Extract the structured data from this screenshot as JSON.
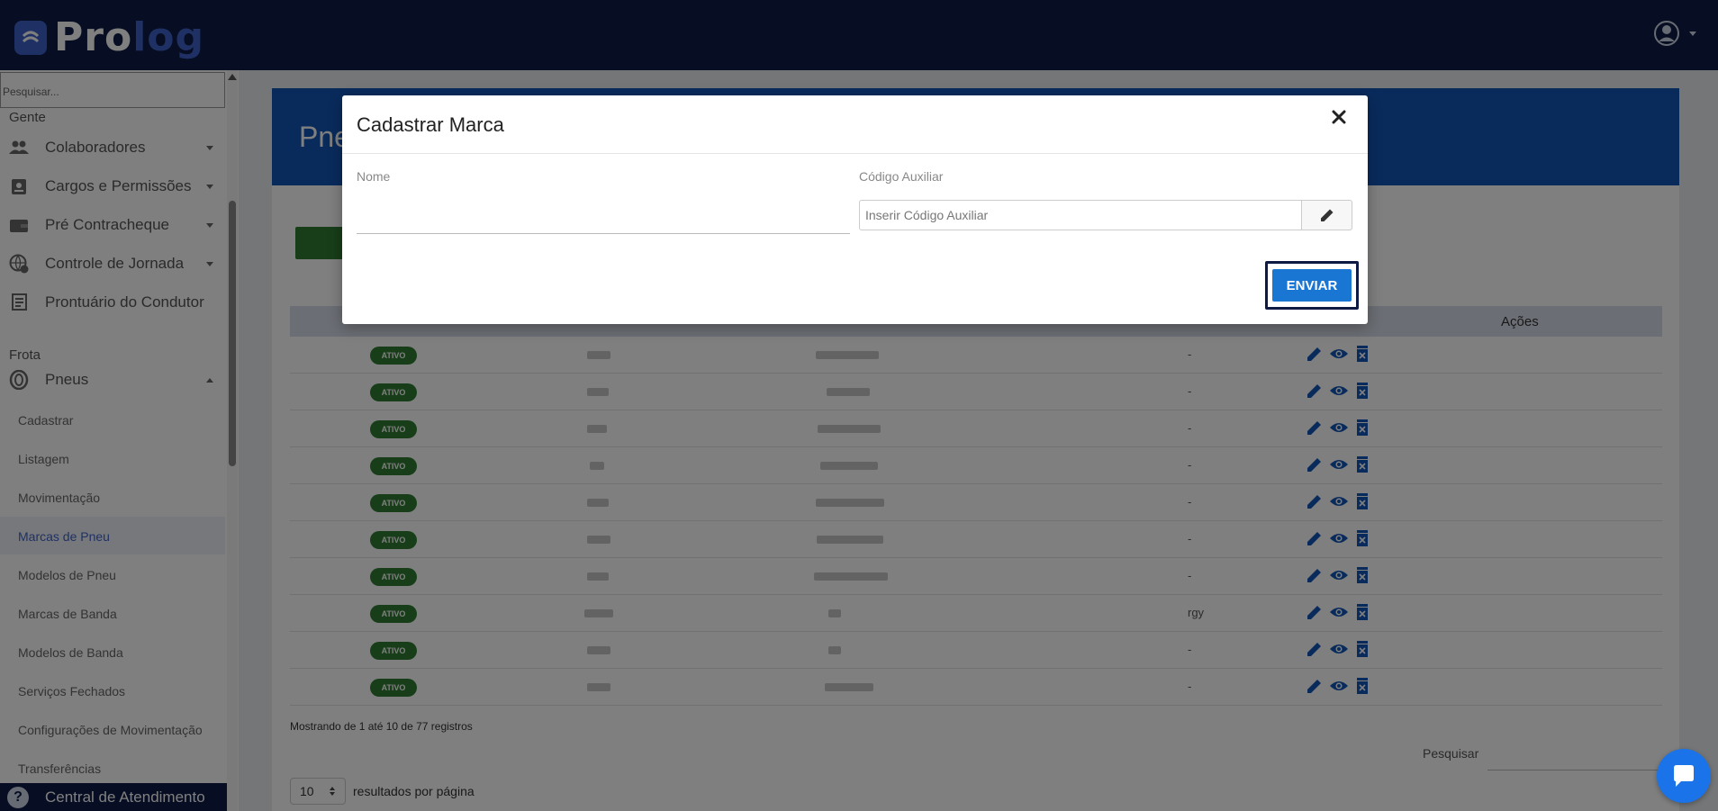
{
  "header": {
    "logo_pro": "Pro",
    "logo_log": "log"
  },
  "sidebar": {
    "search_placeholder": "Pesquisar...",
    "section_gente": "Gente",
    "gente_items": [
      {
        "label": "Colaboradores",
        "icon": "people-icon"
      },
      {
        "label": "Cargos e Permissões",
        "icon": "badge-icon"
      },
      {
        "label": "Pré Contracheque",
        "icon": "wallet-icon"
      },
      {
        "label": "Controle de Jornada",
        "icon": "clock-globe-icon"
      },
      {
        "label": "Prontuário do Condutor",
        "icon": "document-icon"
      }
    ],
    "section_frota": "Frota",
    "pneus_label": "Pneus",
    "sub_items": [
      "Cadastrar",
      "Listagem",
      "Movimentação",
      "Marcas de Pneu",
      "Modelos de Pneu",
      "Marcas de Banda",
      "Modelos de Banda",
      "Serviços Fechados",
      "Configurações de Movimentação",
      "Transferências"
    ],
    "active_sub": "Marcas de Pneu",
    "help_label": "Central de Atendimento"
  },
  "main": {
    "title_partial": "Pne",
    "table_header_acoes": "Ações",
    "rows": [
      {
        "status": "ATIVO",
        "codigo_aux": "-"
      },
      {
        "status": "ATIVO",
        "codigo_aux": "-"
      },
      {
        "status": "ATIVO",
        "codigo_aux": "-"
      },
      {
        "status": "ATIVO",
        "codigo_aux": "-"
      },
      {
        "status": "ATIVO",
        "codigo_aux": "-"
      },
      {
        "status": "ATIVO",
        "codigo_aux": "-"
      },
      {
        "status": "ATIVO",
        "codigo_aux": "-"
      },
      {
        "status": "ATIVO",
        "codigo_aux": "rgy"
      },
      {
        "status": "ATIVO",
        "codigo_aux": "-"
      },
      {
        "status": "ATIVO",
        "codigo_aux": "-"
      }
    ],
    "footer_info": "Mostrando de 1 até 10 de 77 registros",
    "search_label": "Pesquisar",
    "page_length": "10",
    "page_length_label": "resultados por página"
  },
  "modal": {
    "title": "Cadastrar Marca",
    "nome_label": "Nome",
    "nome_value": "",
    "codigo_label": "Código Auxiliar",
    "codigo_placeholder": "Inserir Código Auxiliar",
    "submit_label": "ENVIAR"
  },
  "colors": {
    "header_bg": "#0f1a44",
    "brand_blue": "#3f63c9",
    "card_header": "#1357b8",
    "status_green": "#2e7d32",
    "primary_button": "#1976d2",
    "action_icon": "#1357b8"
  }
}
